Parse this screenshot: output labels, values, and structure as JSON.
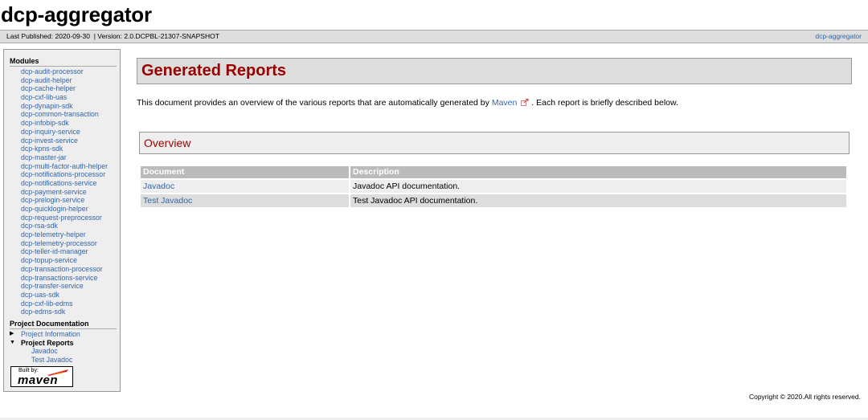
{
  "banner": {
    "title": "dcp-aggregator"
  },
  "breadcrumbs": {
    "published": "Last Published: 2020-09-30",
    "version": "| Version: 2.0.DCPBL-21307-SNAPSHOT",
    "right_link": "dcp-aggregator"
  },
  "nav": {
    "modules_heading": "Modules",
    "modules": [
      "dcp-audit-processor",
      "dcp-audit-helper",
      "dcp-cache-helper",
      "dcp-cxf-lib-uas",
      "dcp-dynapin-sdk",
      "dcp-common-transaction",
      "dcp-infobip-sdk",
      "dcp-inquiry-service",
      "dcp-invest-service",
      "dcp-kpns-sdk",
      "dcp-master-jar",
      "dcp-multi-factor-auth-helper",
      "dcp-notifications-processor",
      "dcp-notifications-service",
      "dcp-payment-service",
      "dcp-prelogin-service",
      "dcp-quicklogin-helper",
      "dcp-request-preprocessor",
      "dcp-rsa-sdk",
      "dcp-telemetry-helper",
      "dcp-telemetry-processor",
      "dcp-teller-id-manager",
      "dcp-topup-service",
      "dcp-transaction-processor",
      "dcp-transactions-service",
      "dcp-transfer-service",
      "dcp-uas-sdk",
      "dcp-cxf-lib-edms",
      "dcp-edms-sdk"
    ],
    "project_doc_heading": "Project Documentation",
    "project_information": "Project Information",
    "project_reports": "Project Reports",
    "report_links": [
      "Javadoc",
      "Test Javadoc"
    ],
    "powered_by": {
      "built": "Built by:",
      "name": "maven"
    }
  },
  "main": {
    "title": "Generated Reports",
    "intro_before": "This document provides an overview of the various reports that are automatically generated by",
    "intro_link": "Maven",
    "intro_after": ". Each report is briefly described below.",
    "section_title": "Overview",
    "table": {
      "headers": [
        "Document",
        "Description"
      ],
      "rows": [
        {
          "name": "Javadoc",
          "desc": "Javadoc API documentation."
        },
        {
          "name": "Test Javadoc",
          "desc": "Test Javadoc API documentation."
        }
      ]
    }
  },
  "footer": {
    "copyright": "Copyright © 2020.All rights reserved."
  },
  "colors": {
    "link": "#3366aa",
    "title": "#990000",
    "header_bg": "#bbbbbb"
  },
  "icons": {
    "external_link": "external-link-icon",
    "expand": "caret-right-icon",
    "collapse": "caret-down-icon"
  }
}
